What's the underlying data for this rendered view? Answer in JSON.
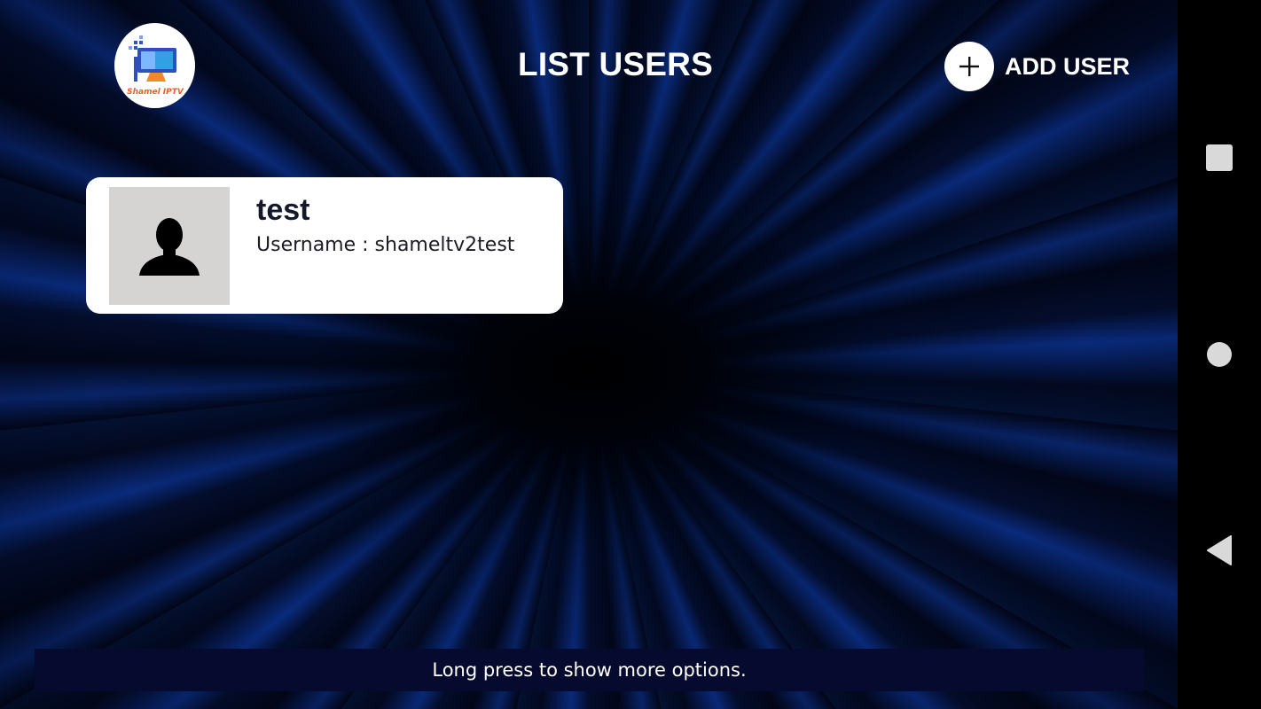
{
  "header": {
    "logo_text": "Shamel IPTV",
    "title": "LIST USERS",
    "add_user_label": "ADD USER"
  },
  "users": [
    {
      "name": "test",
      "username_line": "Username : shameltv2test",
      "avatar_icon": "person-silhouette-icon"
    }
  ],
  "hint": "Long press to show more options.",
  "nav": {
    "recents_icon": "square-icon",
    "home_icon": "circle-icon",
    "back_icon": "triangle-back-icon"
  },
  "colors": {
    "accent_blue": "#0b3290",
    "card_bg": "#ffffff",
    "avatar_bg": "#d6d3d3",
    "hint_bg": "#050a2e",
    "nav_icon": "#d9d9d9"
  }
}
